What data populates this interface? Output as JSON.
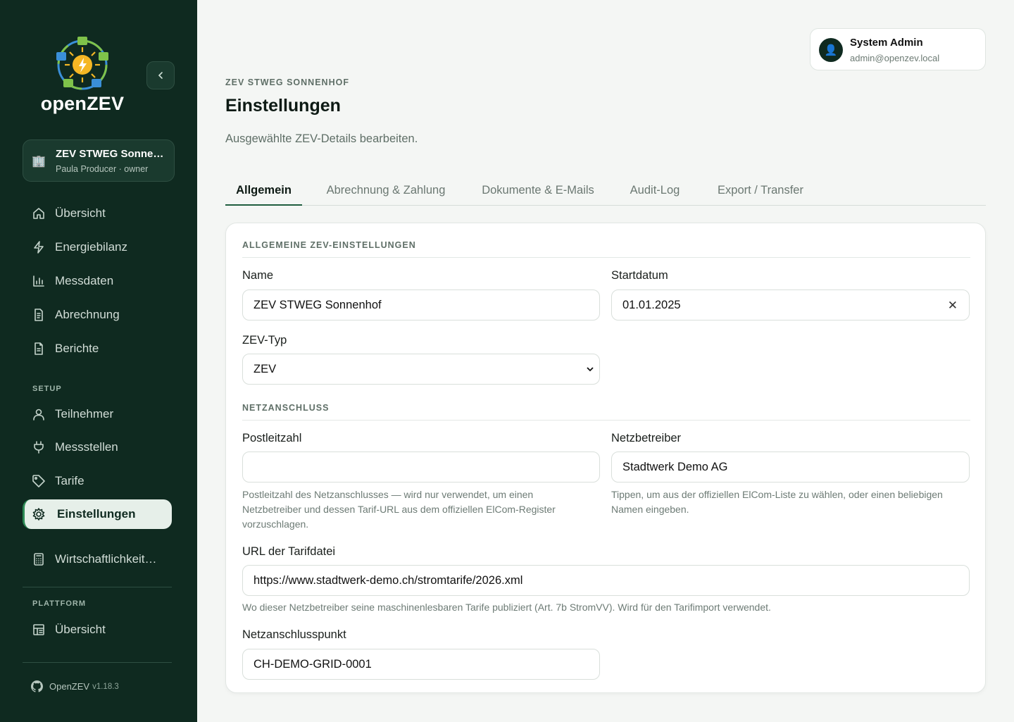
{
  "brand": {
    "logo_text": "openZEV"
  },
  "zev_selector": {
    "title": "ZEV STWEG Sonnenhof",
    "subtitle": "Paula Producer · owner"
  },
  "nav": {
    "main": [
      {
        "label": "Übersicht",
        "icon": "home-icon"
      },
      {
        "label": "Energiebilanz",
        "icon": "bolt-icon"
      },
      {
        "label": "Messdaten",
        "icon": "bar-chart-icon"
      },
      {
        "label": "Abrechnung",
        "icon": "invoice-icon"
      },
      {
        "label": "Berichte",
        "icon": "document-icon"
      }
    ],
    "setup_label": "SETUP",
    "setup": [
      {
        "label": "Teilnehmer",
        "icon": "user-icon"
      },
      {
        "label": "Messstellen",
        "icon": "plug-icon"
      },
      {
        "label": "Tarife",
        "icon": "tag-icon"
      },
      {
        "label": "Einstellungen",
        "icon": "settings-icon"
      }
    ],
    "extra": [
      {
        "label": "Wirtschaftlichkeitsrechner",
        "icon": "calculator-icon"
      }
    ],
    "platform_label": "PLATTFORM",
    "platform": [
      {
        "label": "Übersicht",
        "icon": "dashboard-icon"
      }
    ]
  },
  "footer": {
    "name": "OpenZEV",
    "version": "v1.18.3"
  },
  "user": {
    "name": "System Admin",
    "email": "admin@openzev.local"
  },
  "header": {
    "eyebrow": "ZEV STWEG SONNENHOF",
    "title": "Einstellungen",
    "subtitle": "Ausgewählte ZEV-Details bearbeiten."
  },
  "tabs": [
    {
      "label": "Allgemein",
      "active": true
    },
    {
      "label": "Abrechnung & Zahlung",
      "active": false
    },
    {
      "label": "Dokumente & E-Mails",
      "active": false
    },
    {
      "label": "Audit-Log",
      "active": false
    },
    {
      "label": "Export / Transfer",
      "active": false
    }
  ],
  "general": {
    "heading": "ALLGEMEINE ZEV-EINSTELLUNGEN",
    "name_label": "Name",
    "name_value": "ZEV STWEG Sonnenhof",
    "start_label": "Startdatum",
    "start_value": "01.01.2025",
    "type_label": "ZEV-Typ",
    "type_value": "ZEV"
  },
  "grid": {
    "heading": "NETZANSCHLUSS",
    "zip_label": "Postleitzahl",
    "zip_value": "",
    "zip_help": "Postleitzahl des Netzanschlusses — wird nur verwendet, um einen Netzbetreiber und dessen Tarif-URL aus dem offiziellen ElCom-Register vorzuschlagen.",
    "operator_label": "Netzbetreiber",
    "operator_value": "Stadtwerk Demo AG",
    "operator_help": "Tippen, um aus der offiziellen ElCom-Liste zu wählen, oder einen beliebigen Namen eingeben.",
    "tariff_url_label": "URL der Tarifdatei",
    "tariff_url_value": "https://www.stadtwerk-demo.ch/stromtarife/2026.xml",
    "tariff_url_help": "Wo dieser Netzbetreiber seine maschinenlesbaren Tarife publiziert (Art. 7b StromVV). Wird für den Tarifimport verwendet.",
    "connection_label": "Netzanschlusspunkt",
    "connection_value": "CH-DEMO-GRID-0001"
  }
}
